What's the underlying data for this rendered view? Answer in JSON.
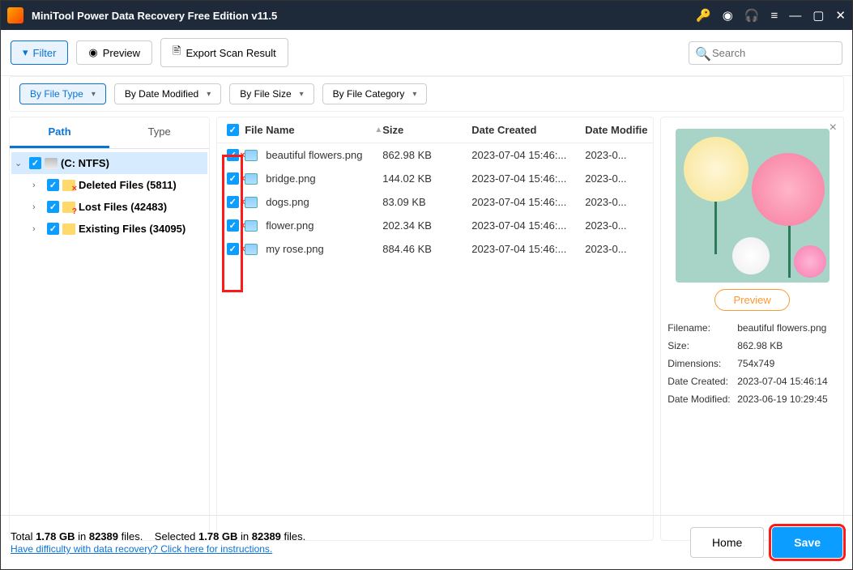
{
  "titlebar": {
    "title": "MiniTool Power Data Recovery Free Edition v11.5"
  },
  "toolbar": {
    "filter": "Filter",
    "preview": "Preview",
    "export": "Export Scan Result",
    "search_placeholder": "Search"
  },
  "filters": {
    "by_type": "By File Type",
    "by_date": "By Date Modified",
    "by_size": "By File Size",
    "by_cat": "By File Category"
  },
  "tabs": {
    "path": "Path",
    "type": "Type"
  },
  "tree": {
    "drive": "(C: NTFS)",
    "deleted": "Deleted Files (5811)",
    "lost": "Lost Files (42483)",
    "existing": "Existing Files (34095)"
  },
  "columns": {
    "name": "File Name",
    "size": "Size",
    "dc": "Date Created",
    "dm": "Date Modifie"
  },
  "files": [
    {
      "name": "beautiful flowers.png",
      "size": "862.98 KB",
      "dc": "2023-07-04 15:46:...",
      "dm": "2023-0..."
    },
    {
      "name": "bridge.png",
      "size": "144.02 KB",
      "dc": "2023-07-04 15:46:...",
      "dm": "2023-0..."
    },
    {
      "name": "dogs.png",
      "size": "83.09 KB",
      "dc": "2023-07-04 15:46:...",
      "dm": "2023-0..."
    },
    {
      "name": "flower.png",
      "size": "202.34 KB",
      "dc": "2023-07-04 15:46:...",
      "dm": "2023-0..."
    },
    {
      "name": "my rose.png",
      "size": "884.46 KB",
      "dc": "2023-07-04 15:46:...",
      "dm": "2023-0..."
    }
  ],
  "detail": {
    "preview_btn": "Preview",
    "k_filename": "Filename:",
    "v_filename": "beautiful flowers.png",
    "k_size": "Size:",
    "v_size": "862.98 KB",
    "k_dim": "Dimensions:",
    "v_dim": "754x749",
    "k_dc": "Date Created:",
    "v_dc": "2023-07-04 15:46:14",
    "k_dm": "Date Modified:",
    "v_dm": "2023-06-19 10:29:45"
  },
  "footer": {
    "total_pre": "Total ",
    "total_size": "1.78 GB",
    "total_mid": " in ",
    "total_count": "82389",
    "total_post": " files.",
    "sel_pre": "Selected ",
    "sel_size": "1.78 GB",
    "sel_mid": " in ",
    "sel_count": "82389",
    "sel_post": " files.",
    "help_link": "Have difficulty with data recovery? Click here for instructions.",
    "home": "Home",
    "save": "Save"
  }
}
